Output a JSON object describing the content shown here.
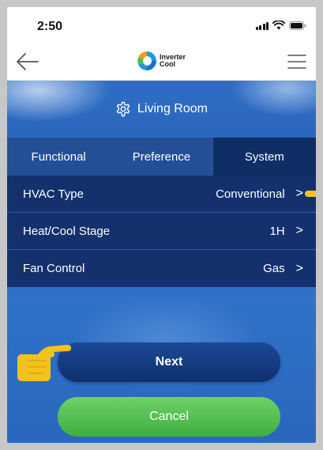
{
  "status_bar": {
    "time": "2:50",
    "icons": [
      "signal-icon",
      "wifi-icon",
      "battery-icon"
    ]
  },
  "header": {
    "logo_line1": "Inverter",
    "logo_line2": "Cool",
    "back_icon": "back-arrow-icon",
    "menu_icon": "hamburger-menu-icon"
  },
  "room": {
    "title": "Living Room",
    "icon": "gear-icon"
  },
  "tabs": [
    {
      "label": "Functional",
      "active": false
    },
    {
      "label": "Preference",
      "active": false
    },
    {
      "label": "System",
      "active": true
    }
  ],
  "settings": [
    {
      "label": "HVAC Type",
      "value": "Conventional"
    },
    {
      "label": "Heat/Cool Stage",
      "value": "1H"
    },
    {
      "label": "Fan Control",
      "value": "Gas"
    }
  ],
  "buttons": {
    "next": "Next",
    "cancel": "Cancel"
  },
  "colors": {
    "accent_blue": "#14316e",
    "tab_active": "#0f2e66",
    "cancel_green": "#4cbc48",
    "pointer_yellow": "#f3c320"
  }
}
